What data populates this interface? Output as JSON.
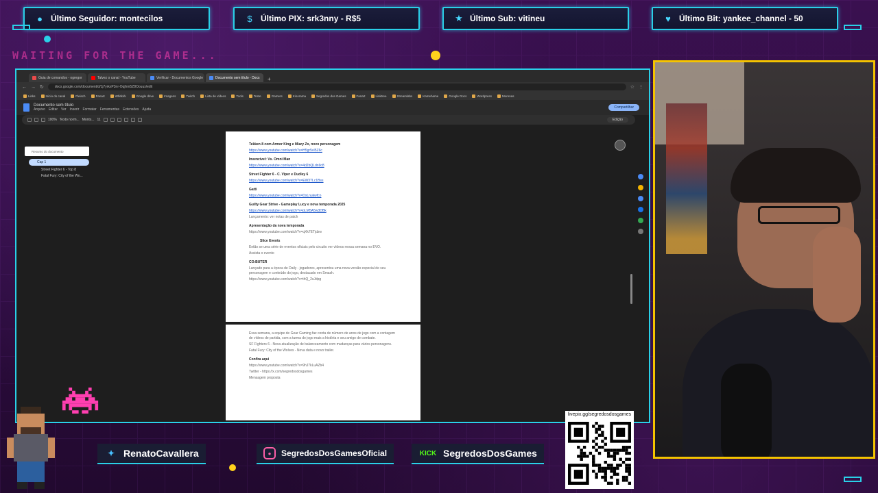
{
  "overlay": {
    "alerts": [
      {
        "icon": "user-icon",
        "text": "Último Seguidor: montecilos"
      },
      {
        "icon": "dollar-icon",
        "text": "Último PIX: srk3nny - R$5"
      },
      {
        "icon": "star-icon",
        "text": "Último Sub: vitineu"
      },
      {
        "icon": "heart-icon",
        "text": "Último Bit: yankee_channel - 50"
      }
    ],
    "waiting_text": "WAITING FOR THE GAME...",
    "socials": [
      {
        "icon": "twitter-icon",
        "label": "RenatoCavallera"
      },
      {
        "icon": "instagram-icon",
        "label": "SegredosDosGamesOficial"
      },
      {
        "icon": "kick-icon",
        "badge": "KICK",
        "label": "SegredosDosGames"
      }
    ],
    "qr_label": "livepix.gg/segredosdosgames",
    "colors": {
      "frame": "#2ad0e8",
      "cam_border": "#f5c400",
      "bg": "#2a0d3a",
      "accent_pink": "#ff3fb0"
    }
  },
  "browser": {
    "tabs": [
      "Guia de comandos - ogregor",
      "Talvez o canal - YouTube",
      "Verificar - Documentos Google",
      "Documento sem título - Docs"
    ],
    "url": "docs.google.com/document/d/1j7yrkxP3nr-Oqjhm5Z8Oouux/edit",
    "bookmarks": [
      "Links",
      "Inicio do canal",
      "Fleisch",
      "Fanart",
      "Whitkirk",
      "Google drive",
      "Imagens",
      "Twitch",
      "Lista de vídeos",
      "Tools",
      "Teste",
      "Gamers",
      "Kinorama",
      "Segredos dos Games",
      "Fanart",
      "Linktree",
      "Streamlabs",
      "Kamehame",
      "Google Docs",
      "Wordpress",
      "Morenas"
    ],
    "doc_title": "Documento sem título",
    "menus": [
      "Arquivo",
      "Editar",
      "Ver",
      "Inserir",
      "Formatar",
      "Ferramentas",
      "Extensões",
      "Ajuda"
    ],
    "share_label": "Compartilhar",
    "edit_label": "Edição",
    "zoom": "100%",
    "style": "Texto norm...",
    "font": "Monts...",
    "font_size": "11",
    "outline": {
      "head": "Resumo do documento",
      "selected": "Cap 1",
      "items": [
        "Street Fighter 6 - Top 8",
        "Fatal Fury: City of the Wo..."
      ]
    }
  },
  "document": {
    "page1": [
      {
        "type": "h",
        "text": "Tekken 8 com Armor King e Miary Zo, novo personagem"
      },
      {
        "type": "link",
        "text": "https://www.youtube.com/watch?v=H5gr5vI5Z6c"
      },
      {
        "type": "h",
        "text": "Invencível: Vs. Omni Man"
      },
      {
        "type": "link",
        "text": "https://www.youtube.com/watch?v=4d2bQLdn9c8"
      },
      {
        "type": "h",
        "text": "Street Fighter 6 - C. Viper e Dudley 6"
      },
      {
        "type": "link",
        "text": "https://www.youtube.com/watch?v=EW3TLc1Bss"
      },
      {
        "type": "h",
        "text": "Gatti"
      },
      {
        "type": "link",
        "text": "https://www.youtube.com/watch?v=DxLnukwfco"
      },
      {
        "type": "h",
        "text": "Guilty Gear Strive - Gameplay Lucy e nova temporada 2025"
      },
      {
        "type": "link",
        "text": "https://www.youtube.com/watch?v=pLM5A5w3DBk"
      },
      {
        "type": "muted",
        "text": "Lançamento: ver notas de patch"
      },
      {
        "type": "h",
        "text": "Apresentação da nova temporada"
      },
      {
        "type": "muted",
        "text": "https://www.youtube.com/watch?v=qXk7ETjdzw"
      },
      {
        "type": "bullet",
        "text": "Slice Events"
      },
      {
        "type": "muted",
        "text": "Então se uma série de eventos oficiais pelo circuito ver vídeos nessa semana no EVO."
      },
      {
        "type": "muted",
        "text": "Assista o evento"
      },
      {
        "type": "h",
        "text": "CO:BUTER"
      },
      {
        "type": "muted",
        "text": "Lançado para a época de Daily - jogadores, apresentou uma nova versão especial de seu personagem e conteúdo do jogo, destacado em Smash."
      },
      {
        "type": "muted",
        "text": "https://www.youtube.com/watch?v=thQ_2sJdpg"
      }
    ],
    "page2": [
      {
        "type": "muted",
        "text": "Essa semana, a equipe de Gear Gaming faz conta de número de anos de jogo com a contagem de vídeos de partida, com a turma do jogo mais a história e seu amigo de combate."
      },
      {
        "type": "muted",
        "text": "SF Fighters 6 - Nova atualização de balanceamento com mudanças para vários personagens."
      },
      {
        "type": "muted",
        "text": "Fatal Fury: City of the Wolves - Nova data e novo trailer."
      },
      {
        "type": "h",
        "text": "Confira aqui"
      },
      {
        "type": "muted",
        "text": "https://www.youtube.com/watch?v=9hJ7kLuAZb4"
      },
      {
        "type": "muted",
        "text": "Twitter - https://x.com/segredosdosgames"
      },
      {
        "type": "muted",
        "text": "Mensagem proposta"
      }
    ]
  }
}
